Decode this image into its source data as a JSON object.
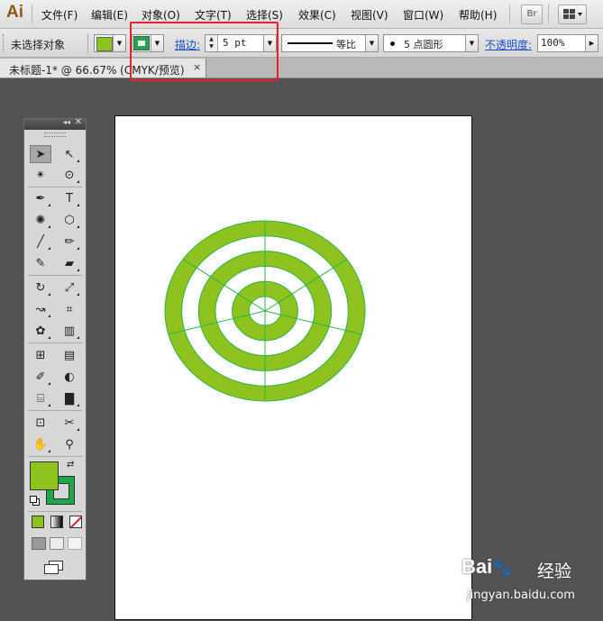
{
  "app": {
    "logo": "Ai"
  },
  "menubar": {
    "items": [
      {
        "label": "文件(F)"
      },
      {
        "label": "编辑(E)"
      },
      {
        "label": "对象(O)"
      },
      {
        "label": "文字(T)"
      },
      {
        "label": "选择(S)"
      },
      {
        "label": "效果(C)"
      },
      {
        "label": "视图(V)"
      },
      {
        "label": "窗口(W)"
      },
      {
        "label": "帮助(H)"
      }
    ],
    "bridge_label": "Br"
  },
  "controlbar": {
    "selection_status": "未选择对象",
    "fill_color": "#8dc21f",
    "stroke_color": "#1aa84a",
    "stroke_label": "描边:",
    "stroke_weight": "5 pt",
    "stroke_style_label": "等比",
    "brush_label": "5 点圆形",
    "opacity_label": "不透明度:",
    "opacity_value": "100%"
  },
  "document": {
    "tab_label": "未标题-1* @ 66.67% (CMYK/预览)",
    "close_glyph": "×"
  },
  "artwork": {
    "fill_color": "#8dc21f",
    "stroke_color": "#2fb24a"
  },
  "toolbox": {
    "panel_glyphs": {
      "collapse": "◂◂",
      "close": "✕"
    },
    "tools": {
      "selection": "➤",
      "direct_selection": "↖",
      "magic_wand": "✴",
      "lasso": "⊙",
      "pen": "✒",
      "type": "T",
      "flare": "✺",
      "shape": "⬡",
      "paintbrush": "╱",
      "pencil": "✏",
      "blob_brush": "✎",
      "eraser": "▰",
      "rotate": "↻",
      "scale": "⤢",
      "warp": "↝",
      "free_transform": "⌗",
      "symbol_sprayer": "✿",
      "graph": "▥",
      "mesh": "⊞",
      "gradient": "▤",
      "eyedropper": "✐",
      "blend": "◐",
      "slice_select": "⌸",
      "column_graph": "▇",
      "artboard": "⊡",
      "knife": "✂",
      "hand": "✋",
      "zoom": "⚲"
    },
    "fill_color": "#8dc21f",
    "stroke_color": "#1aa84a",
    "swap_glyph": "⇄"
  },
  "watermark": {
    "brand": "Bai",
    "paw": "🐾",
    "cn": "经验",
    "url": "jingyan.baidu.com"
  }
}
